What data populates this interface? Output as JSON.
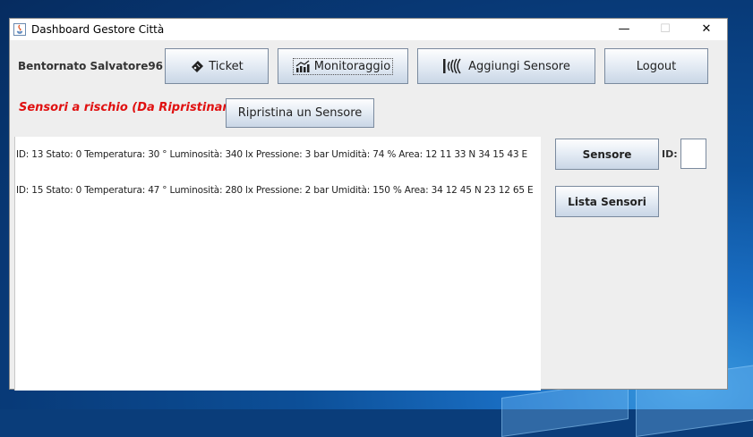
{
  "window": {
    "title": "Dashboard Gestore Città",
    "minimize": "—",
    "maximize": "☐",
    "close": "✕"
  },
  "header": {
    "welcome": "Bentornato Salvatore96",
    "ticket_label": "Ticket",
    "monitoraggio_label": "Monitoraggio",
    "aggiungi_label": "Aggiungi Sensore",
    "logout_label": "Logout"
  },
  "risk": {
    "label": "Sensori a rischio (Da Ripristinare):",
    "restore_button": "Ripristina un Sensore"
  },
  "sensors": [
    "ID: 13 Stato: 0 Temperatura: 30 ° Luminosità: 340 lx Pressione: 3 bar Umidità: 74 % Area: 12 11 33 N 34 15 43 E",
    "ID: 15 Stato: 0 Temperatura: 47 ° Luminosità: 280 lx Pressione: 2 bar Umidità: 150 % Area: 34 12 45 N 23 12 65 E"
  ],
  "side": {
    "sensore_button": "Sensore",
    "id_label": "ID:",
    "id_value": "",
    "lista_button": "Lista Sensori"
  }
}
